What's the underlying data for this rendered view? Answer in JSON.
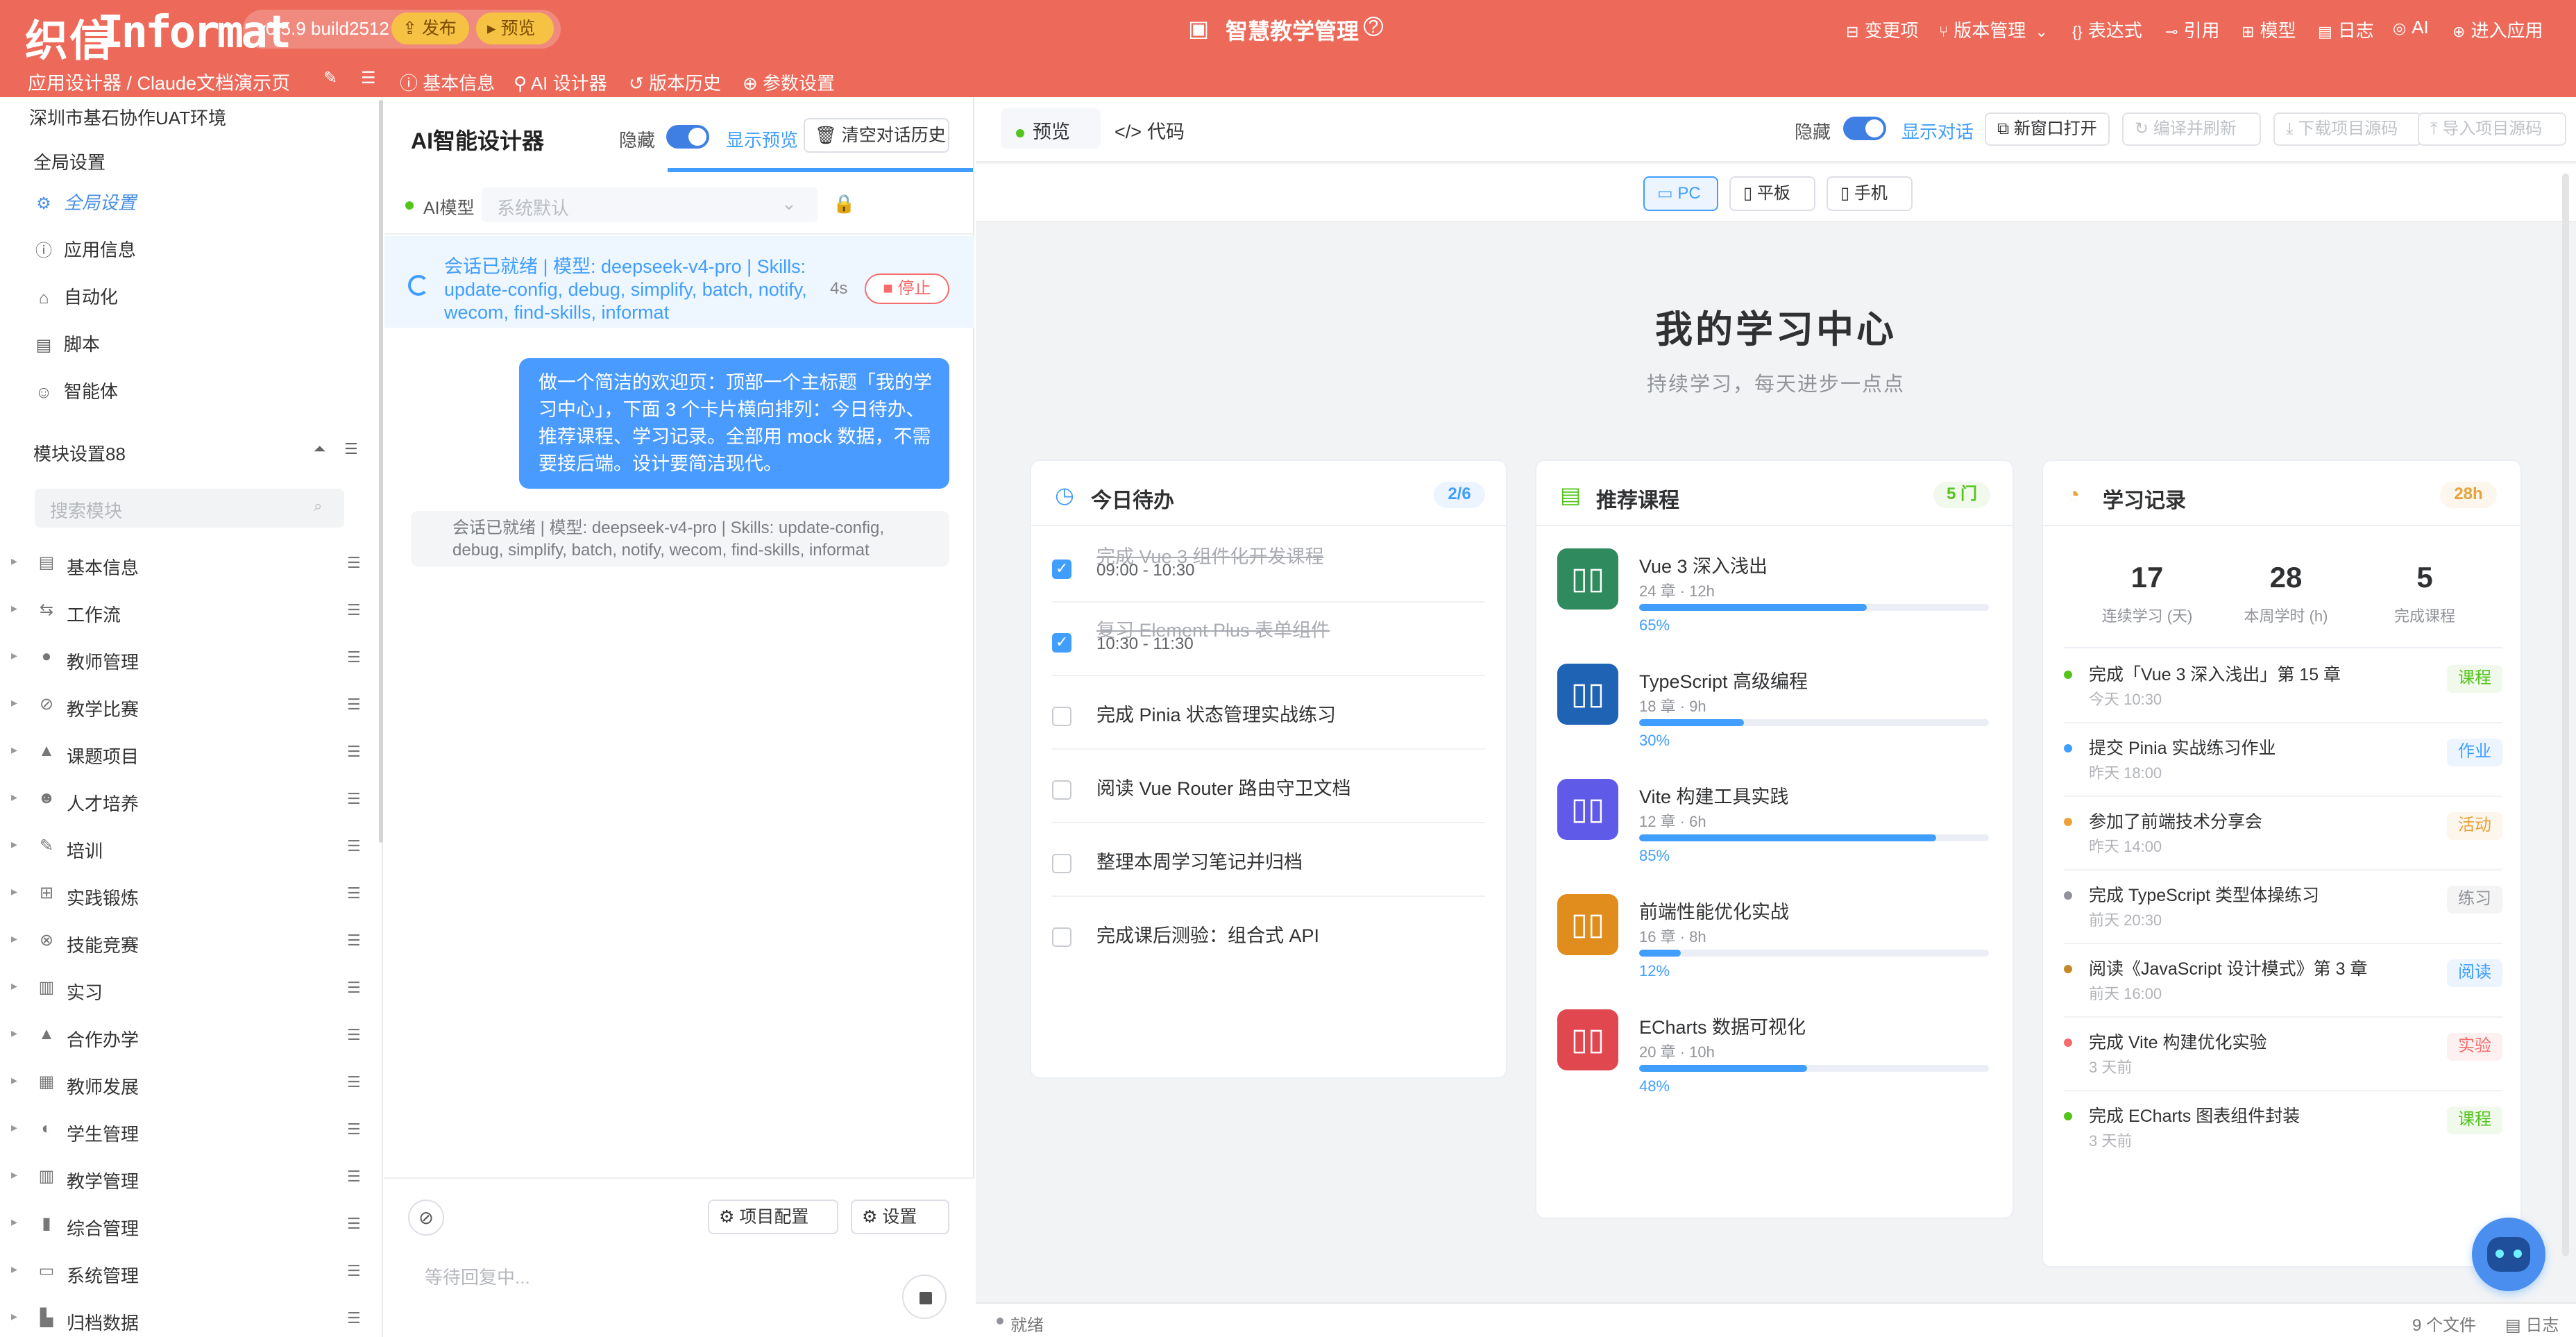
{
  "header": {
    "logo_glyph": "织信",
    "logo_text": "Informat",
    "version": "v0.5.9 build2512",
    "publish_label": "发布",
    "preview_label": "预览",
    "app_title": "智慧教学管理",
    "links": [
      {
        "icon": "changes-icon",
        "label": "变更项"
      },
      {
        "icon": "branch-icon",
        "label": "版本管理"
      },
      {
        "icon": "braces-icon",
        "label": "表达式"
      },
      {
        "icon": "reference-icon",
        "label": "引用"
      },
      {
        "icon": "module-icon",
        "label": "模型"
      },
      {
        "icon": "log-icon",
        "label": "日志"
      },
      {
        "icon": "ai-icon",
        "label": "AI"
      },
      {
        "icon": "enter-icon",
        "label": "进入应用"
      }
    ],
    "breadcrumb": "应用设计器 / Claude文档演示页",
    "tabs": [
      {
        "icon": "info-icon",
        "label": "基本信息"
      },
      {
        "icon": "ai-designer-icon",
        "label": "AI 设计器"
      },
      {
        "icon": "history-icon",
        "label": "版本历史"
      },
      {
        "icon": "params-icon",
        "label": "参数设置"
      }
    ]
  },
  "sidebar": {
    "env": "深圳市基石协作UAT环境",
    "global_section": "全局设置",
    "global_items": [
      {
        "icon": "gear-icon",
        "label": "全局设置"
      },
      {
        "icon": "info-icon",
        "label": "应用信息"
      },
      {
        "icon": "robot-icon",
        "label": "自动化"
      },
      {
        "icon": "script-icon",
        "label": "脚本"
      },
      {
        "icon": "agent-icon",
        "label": "智能体"
      }
    ],
    "module_section": "模块设置88",
    "search_placeholder": "搜索模块",
    "modules": [
      {
        "icon": "doc-icon",
        "label": "基本信息"
      },
      {
        "icon": "flow-icon",
        "label": "工作流"
      },
      {
        "icon": "teacher-icon",
        "label": "教师管理"
      },
      {
        "icon": "contest-icon",
        "label": "教学比赛"
      },
      {
        "icon": "project-icon",
        "label": "课题项目"
      },
      {
        "icon": "people-icon",
        "label": "人才培养"
      },
      {
        "icon": "train-icon",
        "label": "培训"
      },
      {
        "icon": "practice-icon",
        "label": "实践锻炼"
      },
      {
        "icon": "skill-icon",
        "label": "技能竞赛"
      },
      {
        "icon": "intern-icon",
        "label": "实习"
      },
      {
        "icon": "coop-icon",
        "label": "合作办学"
      },
      {
        "icon": "growth-icon",
        "label": "教师发展"
      },
      {
        "icon": "student-icon",
        "label": "学生管理"
      },
      {
        "icon": "teaching-icon",
        "label": "教学管理"
      },
      {
        "icon": "general-icon",
        "label": "综合管理"
      },
      {
        "icon": "system-icon",
        "label": "系统管理"
      },
      {
        "icon": "archive-icon",
        "label": "归档数据"
      }
    ]
  },
  "ai": {
    "title": "AI智能设计器",
    "hide_label": "隐藏",
    "show_preview": "显示预览",
    "clear_label": "清空对话历史",
    "model_label": "AI模型",
    "model_placeholder": "系统默认",
    "status_text": "会话已就绪 | 模型: deepseek-v4-pro | Skills: update-config, debug, simplify, batch, notify, wecom, find-skills, informat",
    "elapsed": "4s",
    "stop_label": "停止",
    "user_message": "做一个简洁的欢迎页：顶部一个主标题「我的学习中心」，下面 3 个卡片横向排列：今日待办、推荐课程、学习记录。全部用 mock 数据，不需要接后端。设计要简洁现代。",
    "system_message": "会话已就绪 | 模型: deepseek-v4-pro | Skills: update-config, debug, simplify, batch, notify, wecom, find-skills, informat",
    "project_config": "项目配置",
    "settings": "设置",
    "input_placeholder": "等待回复中..."
  },
  "preview": {
    "tab_preview": "预览",
    "tab_code": "代码",
    "hide_label": "隐藏",
    "show_dialog": "显示对话",
    "open_new": "新窗口打开",
    "compile_refresh": "编译并刷新",
    "download_src": "下载项目源码",
    "import_src": "导入项目源码",
    "devices": [
      {
        "icon": "monitor-icon",
        "label": "PC"
      },
      {
        "icon": "tablet-icon",
        "label": "平板"
      },
      {
        "icon": "phone-icon",
        "label": "手机"
      }
    ],
    "status": "就绪",
    "file_count": "9 个文件",
    "log_label": "日志"
  },
  "page": {
    "title": "我的学习中心",
    "subtitle": "持续学习，每天进步一点点",
    "todo": {
      "title": "今日待办",
      "badge": "2/6",
      "items": [
        {
          "text": "完成 Vue 3 组件化开发课程",
          "time": "09:00 - 10:30",
          "done": true
        },
        {
          "text": "复习 Element Plus 表单组件",
          "time": "10:30 - 11:30",
          "done": true
        },
        {
          "text": "完成 Pinia 状态管理实战练习",
          "time": "",
          "done": false
        },
        {
          "text": "阅读 Vue Router 路由守卫文档",
          "time": "",
          "done": false
        },
        {
          "text": "整理本周学习笔记并归档",
          "time": "",
          "done": false
        },
        {
          "text": "完成课后测验：组合式 API",
          "time": "",
          "done": false
        }
      ]
    },
    "courses": {
      "title": "推荐课程",
      "badge": "5 门",
      "items": [
        {
          "title": "Vue 3 深入浅出",
          "meta": "24 章 · 12h",
          "progress": 65,
          "pct": "65%",
          "color": "#2f8a5e"
        },
        {
          "title": "TypeScript 高级编程",
          "meta": "18 章 · 9h",
          "progress": 30,
          "pct": "30%",
          "color": "#1f63b4"
        },
        {
          "title": "Vite 构建工具实践",
          "meta": "12 章 · 6h",
          "progress": 85,
          "pct": "85%",
          "color": "#5f5ae8"
        },
        {
          "title": "前端性能优化实战",
          "meta": "16 章 · 8h",
          "progress": 12,
          "pct": "12%",
          "color": "#e08d1e"
        },
        {
          "title": "ECharts 数据可视化",
          "meta": "20 章 · 10h",
          "progress": 48,
          "pct": "48%",
          "color": "#e0474f"
        }
      ]
    },
    "records": {
      "title": "学习记录",
      "badge": "28h",
      "stats": [
        {
          "value": "17",
          "label": "连续学习 (天)"
        },
        {
          "value": "28",
          "label": "本周学时 (h)"
        },
        {
          "value": "5",
          "label": "完成课程"
        }
      ],
      "items": [
        {
          "title": "完成「Vue 3 深入浅出」第 15 章",
          "time": "今天 10:30",
          "tag": "课程",
          "dot": "#52c41a",
          "tag_fg": "#52c41a",
          "tag_bg": "#f0f9eb"
        },
        {
          "title": "提交 Pinia 实战练习作业",
          "time": "昨天 18:00",
          "tag": "作业",
          "dot": "#409eff",
          "tag_fg": "#409eff",
          "tag_bg": "#ecf5ff"
        },
        {
          "title": "参加了前端技术分享会",
          "time": "昨天 14:00",
          "tag": "活动",
          "dot": "#f0a03a",
          "tag_fg": "#e6a23c",
          "tag_bg": "#fdf6ec"
        },
        {
          "title": "完成 TypeScript 类型体操练习",
          "time": "前天 20:30",
          "tag": "练习",
          "dot": "#909399",
          "tag_fg": "#909399",
          "tag_bg": "#f4f4f5"
        },
        {
          "title": "阅读《JavaScript 设计模式》第 3 章",
          "time": "前天 16:00",
          "tag": "阅读",
          "dot": "#c48a26",
          "tag_fg": "#409eff",
          "tag_bg": "#ecf5ff"
        },
        {
          "title": "完成 Vite 构建优化实验",
          "time": "3 天前",
          "tag": "实验",
          "dot": "#f56c6c",
          "tag_fg": "#f56c6c",
          "tag_bg": "#fef0f0"
        },
        {
          "title": "完成 ECharts 图表组件封装",
          "time": "3 天前",
          "tag": "课程",
          "dot": "#52c41a",
          "tag_fg": "#52c41a",
          "tag_bg": "#f0f9eb"
        }
      ]
    }
  }
}
